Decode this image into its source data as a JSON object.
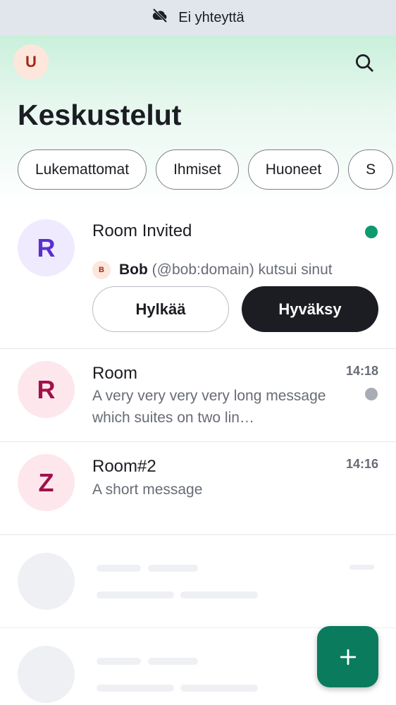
{
  "status": {
    "text": "Ei yhteyttä",
    "icon": "cloud-off-icon"
  },
  "header": {
    "avatar_letter": "U",
    "title": "Keskustelut",
    "search_icon": "search-icon"
  },
  "filters": [
    "Lukemattomat",
    "Ihmiset",
    "Huoneet",
    "S"
  ],
  "invite": {
    "avatar_letter": "R",
    "name": "Room Invited",
    "inviter_avatar_letter": "B",
    "inviter_name": "Bob",
    "inviter_text": "(@bob:domain) kutsui sinut",
    "decline_label": "Hylkää",
    "accept_label": "Hyväksy",
    "indicator_color": "#0b9b6e"
  },
  "rooms": [
    {
      "avatar_letter": "R",
      "name": "Room",
      "message": "A very very very very long message which suites on two lin…",
      "time": "14:18",
      "unread_indicator_color": "#a8adb5"
    },
    {
      "avatar_letter": "Z",
      "name": "Room#2",
      "message": "A short message",
      "time": "14:16"
    }
  ],
  "fab": {
    "label": "+",
    "color": "#0b7b5e"
  }
}
